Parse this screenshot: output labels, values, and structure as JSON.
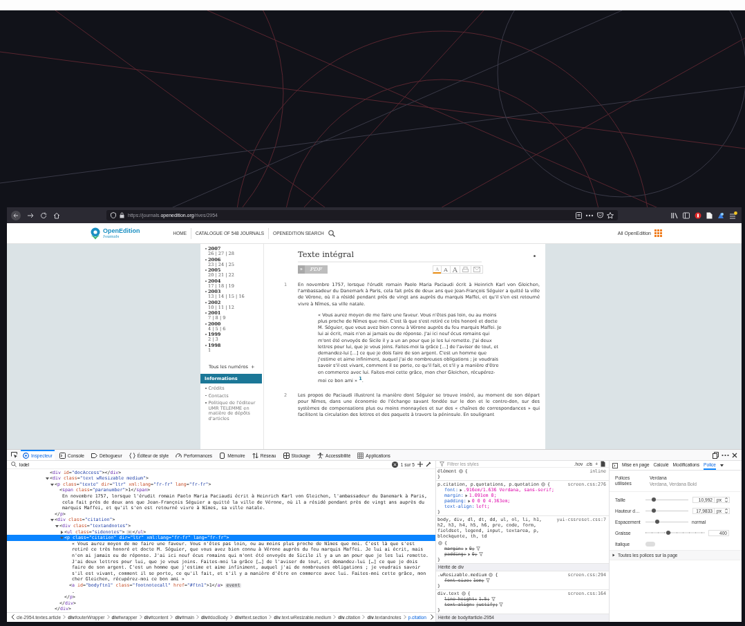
{
  "browser": {
    "url": "https://journals.**openedition.org**/rives/2954"
  },
  "site_header": {
    "logo": {
      "name": "OpenEdition",
      "sub": "Journals"
    },
    "nav": [
      {
        "label": "HOME",
        "kind": "link"
      },
      {
        "label": "CATALOGUE OF 548 JOURNALS",
        "kind": "link"
      },
      {
        "label": "OPENEDITION SEARCH",
        "kind": "search"
      }
    ],
    "all_link": "All OpenEdition"
  },
  "sidebar": {
    "years": [
      {
        "year": "2007",
        "issues": "26 | 27 | 28"
      },
      {
        "year": "2006",
        "issues": "23 | 24 | 25"
      },
      {
        "year": "2005",
        "issues": "20 | 21 | 22"
      },
      {
        "year": "2004",
        "issues": "17 | 18 | 19"
      },
      {
        "year": "2003",
        "issues": "13 | 14 | 15 | 16"
      },
      {
        "year": "2002",
        "issues": "10 | 11 | 12"
      },
      {
        "year": "2001",
        "issues": "7 | 8 | 9"
      },
      {
        "year": "2000",
        "issues": "4 | 5 | 6"
      },
      {
        "year": "1999",
        "issues": "2 | 3"
      },
      {
        "year": "1998",
        "issues": "1"
      }
    ],
    "all_issues": {
      "label": "Tous les numéros",
      "icon": "+"
    },
    "section_title": "Informations",
    "links": [
      "Crédits",
      "Contacts",
      "Politique de l'éditeur UMR TELEMME en matière de dépôts d'articles"
    ]
  },
  "article": {
    "title": "Texte intégral",
    "pdf_arrow": "»",
    "pdf": "PDF",
    "text_sizes": [
      {
        "label": "A",
        "selected": true
      },
      {
        "label": "A",
        "selected": false
      },
      {
        "label": "A",
        "selected": false
      }
    ],
    "blocks": [
      {
        "kind": "paragraph",
        "number": "1",
        "text": "En novembre 1757, lorsque l'érudit romain Paolo Maria Paciaudi écrit à Heinrich Karl von Gleichen, l'ambassadeur du Danemark à Paris, cela fait près de deux ans que Jean-François Séguier a quitté la ville de Vérone, où il a résidé pendant près de vingt ans auprès du marquis Maffei, et qu'il s'en est retourné vivre à Nîmes, sa ville natale."
      },
      {
        "kind": "quote",
        "text": "« Vous aurez moyen de me faire une faveur. Vous n'êtes pas loin, ou au moins plus proche de Nîmes que moi. C'est là que s'est retiré ce très honoré et docte M. Séguier, que vous avez bien connu à Vérone auprès du feu marquis Maffei. Je lui ai écrit, mais n'en ai jamais eu de réponse. J'ai ici neuf écus romains qui m'ont été envoyés de Sicile il y a un an pour que je les lui remette. J'ai deux lettres pour lui, que je vous joins. Faites-moi la grâce […] de l'aviser de tout, et demandez-lui […] ce que je dois faire de son argent. C'est un homme que j'estime et aime infiniment, auquel j'ai de nombreuses obligations ; je voudrais savoir s'il est vivant, comment il se porte, ce qu'il fait, et s'il y a manière d'être en commerce avec lui. Faites-moi cette grâce, mon cher Gleichen, récupérez-moi ce bon ami » $^{1}$."
      },
      {
        "kind": "paragraph",
        "number": "2",
        "text": "Les propos de Paciaudi illustrent la manière dont Séguier se trouve inséré, au moment de son départ pour Nîmes, dans une économie de l'échange savant fondée sur le don et le contre-don, sur des systèmes de compensations plus ou moins monnayées et sur des « chaînes de correspondances » qui facilitent la circulation des lettres et des paquets à travers la péninsule. En soulignant"
      }
    ]
  },
  "devtools": {
    "tools": [
      {
        "label": "Inspecteur",
        "kind": "inspector",
        "selected": true
      },
      {
        "label": "Console",
        "kind": "console",
        "selected": false
      },
      {
        "label": "Débogueur",
        "kind": "debugger",
        "selected": false
      },
      {
        "label": "Éditeur de style",
        "kind": "style",
        "selected": false
      },
      {
        "label": "Performances",
        "kind": "performance",
        "selected": false
      },
      {
        "label": "Mémoire",
        "kind": "memory",
        "selected": false
      },
      {
        "label": "Réseau",
        "kind": "network",
        "selected": false
      },
      {
        "label": "Stockage",
        "kind": "storage",
        "selected": false
      },
      {
        "label": "Accessibilité",
        "kind": "accessibility",
        "selected": false
      },
      {
        "label": "Applications",
        "kind": "application",
        "selected": false
      }
    ],
    "search": {
      "value": "lodel",
      "matches": "1 sur 5"
    },
    "markup": [
      {
        "kind": "leaf",
        "text": "<div id=\"docAccess\"></div>",
        "selected": false
      },
      {
        "kind": "branch",
        "text": "<div class=\"text wResizable medium\">",
        "expanded": true,
        "selected": false,
        "children": [
          {
            "kind": "branch",
            "text": "<p class=\"texte\" dir=\"ltr\" xml:lang=\"fr-fr\" lang=\"fr-fr\">",
            "expanded": true,
            "selected": false,
            "close": "</p>",
            "children": [
              {
                "kind": "leaf",
                "text": "<span class=\"paranumber\">1</span>",
                "selected": false
              },
              {
                "kind": "text",
                "text": "En novembre 1757, lorsque l'érudit romain Paolo Maria Paciaudi écrit à Heinrich Karl von Gleichen, l'ambassadeur du Danemark à Paris, cela fait près de deux ans que Jean-François Séguier a quitté la ville de Vérone, où il a résidé pendant près de vingt ans auprès du marquis Maffei, et qu'il s'en est retourné vivre à Nîmes, sa ville natale.",
                "selected": false
              }
            ]
          },
          {
            "kind": "branch",
            "text": "<div class=\"citation\">",
            "expanded": true,
            "selected": false,
            "close": "</div>",
            "children": [
              {
                "kind": "branch",
                "text": "<div class=\"textandnotes\">",
                "expanded": true,
                "selected": false,
                "close": "</div>",
                "children": [
                  {
                    "kind": "branch",
                    "text": "<ul class=\"sidenotes\">",
                    "expanded": false,
                    "selected": false,
                    "ellipsis": "⋯",
                    "close": "</ul>"
                  },
                  {
                    "kind": "branch",
                    "text": "<p class=\"citation\" dir=\"ltr\" xml:lang=\"fr-fr\" lang=\"fr-fr\">",
                    "expanded": true,
                    "selected": true,
                    "close": "</p>",
                    "children": [
                      {
                        "kind": "text",
                        "text": "« Vous aurez moyen de me faire une faveur. Vous n'êtes pas loin, ou au moins plus proche de Nîmes que moi. C'est là que s'est retiré ce très honoré et docte M. Séguier, que vous avez bien connu à Vérone auprès du feu marquis Maffei. Je lui ai écrit, mais n'en ai jamais eu de réponse. J'ai ici neuf écus romains qui m'ont été envoyés de Sicile il y a un an pour que je les lui remette. J'ai deux lettres pour lui, que je vous joins. Faites-moi la grâce […] de l'aviser de tout, et demandez-lui […] ce que je dois faire de son argent. C'est un homme que j'estime et aime infiniment, auquel j'ai de nombreuses obligations ; je voudrais savoir s'il est vivant, comment il se porte, ce qu'il fait, et s'il y a manière d'être en commerce avec lui. Faites-moi cette grâce, mon cher Gleichen, récupérez-moi ce bon ami »",
                        "selected": false
                      },
                      {
                        "kind": "leaf",
                        "text": "<a id=\"bodyftn1\" class=\"footnotecall\" href=\"#ftn1\">1</a>",
                        "badge": "event",
                        "selected": false
                      },
                      {
                        "kind": "text",
                        "text": ".",
                        "selected": false
                      }
                    ]
                  }
                ]
              }
            ]
          }
        ]
      }
    ],
    "breadcrumbs": [
      {
        "label": "cle-2954.textes.article",
        "selected": false
      },
      {
        "label": "**div**#outerWrapper",
        "selected": false
      },
      {
        "label": "**div**#wrapper",
        "selected": false
      },
      {
        "label": "**div**#content",
        "selected": false
      },
      {
        "label": "**div**#main",
        "selected": false
      },
      {
        "label": "**div**#docBody",
        "selected": false
      },
      {
        "label": "**div**#text.section",
        "selected": false
      },
      {
        "label": "**div**.text.wResizable.medium",
        "selected": false
      },
      {
        "label": "**div**.citation",
        "selected": false
      },
      {
        "label": "**div**.textandnotes",
        "selected": false
      },
      {
        "label": "p.citation",
        "selected": true
      }
    ],
    "rules": {
      "filter_placeholder": "Filtrer les styles",
      "buttons": [
        ".hov",
        ".cls",
        "+"
      ],
      "items": [
        {
          "kind": "rule",
          "selector": "élément",
          "open": "{",
          "close": "}",
          "source": "inline"
        },
        {
          "kind": "rule",
          "selector": "p.citation, p.quotations, p.quotation",
          "open": "{",
          "close": "}",
          "source": "screen.css:276",
          "decls": [
            {
              "name": "font:",
              "value": ".916em/1.636 Verdana, sans-serif;",
              "expandable": true,
              "overridden": false
            },
            {
              "name": "margin:",
              "value": "1.091em 0;",
              "expandable": true,
              "overridden": false
            },
            {
              "name": "padding:",
              "value": "0 0 0 4.363em;",
              "expandable": true,
              "overridden": false
            },
            {
              "name": "text-align:",
              "value": "left;",
              "expandable": false,
              "overridden": false
            }
          ]
        },
        {
          "kind": "rule",
          "selector": "body, div, dl, dt, dd, ul, ol, li, h1, h2, h3, h4, h5, h6, pre, code, form, fieldset, legend, input, textarea, p, blockquote, th, td",
          "open": "{",
          "close": "}",
          "source": "yui-cssreset.css:7",
          "decls": [
            {
              "name": "margin:",
              "value": "0;",
              "expandable": true,
              "overridden": true
            },
            {
              "name": "padding:",
              "value": "0;",
              "expandable": true,
              "overridden": true
            }
          ]
        },
        {
          "kind": "inherited",
          "label": "Hérité de div"
        },
        {
          "kind": "rule",
          "selector": ".wResizable.medium",
          "open": "{",
          "close": "}",
          "source": "screen.css:294",
          "decls": [
            {
              "name": "font-size:",
              "value": "1em;",
              "expandable": false,
              "overridden": true
            }
          ]
        },
        {
          "kind": "rule",
          "selector": "div.text",
          "open": "{",
          "close": "}",
          "source": "screen.css:164",
          "decls": [
            {
              "name": "line-height:",
              "value": "1.5;",
              "expandable": false,
              "overridden": true
            },
            {
              "name": "text-align:",
              "value": "justify;",
              "expandable": false,
              "overridden": true
            }
          ]
        },
        {
          "kind": "inherited",
          "label": "Hérité de body#article-2954"
        }
      ]
    },
    "side_panel": {
      "tabs": [
        {
          "label": "Mise en page",
          "selected": false
        },
        {
          "label": "Calculé",
          "selected": false
        },
        {
          "label": "Modifications",
          "selected": false
        },
        {
          "label": "Police",
          "selected": true
        }
      ],
      "fonts_used_label": "Polices utilisées",
      "font_name": "Verdana",
      "font_faces": "Verdana, Verdana Bold",
      "controls": [
        {
          "kind": "slider",
          "label": "Taille",
          "level": 0.2,
          "value": "10,992",
          "unit": "px"
        },
        {
          "kind": "slider",
          "label": "Hauteur d…",
          "level": 0.2,
          "value": "17,9833",
          "unit": "px"
        },
        {
          "kind": "slider-text",
          "label": "Espacement",
          "level": 0.27,
          "reading": "normal"
        },
        {
          "kind": "ticks",
          "label": "Graisse",
          "level": 0.38,
          "value": "400"
        },
        {
          "kind": "toggle",
          "label": "Italique",
          "on": false
        }
      ],
      "all_fonts": {
        "label": "Toutes les polices sur la page",
        "expanded": false
      }
    }
  }
}
